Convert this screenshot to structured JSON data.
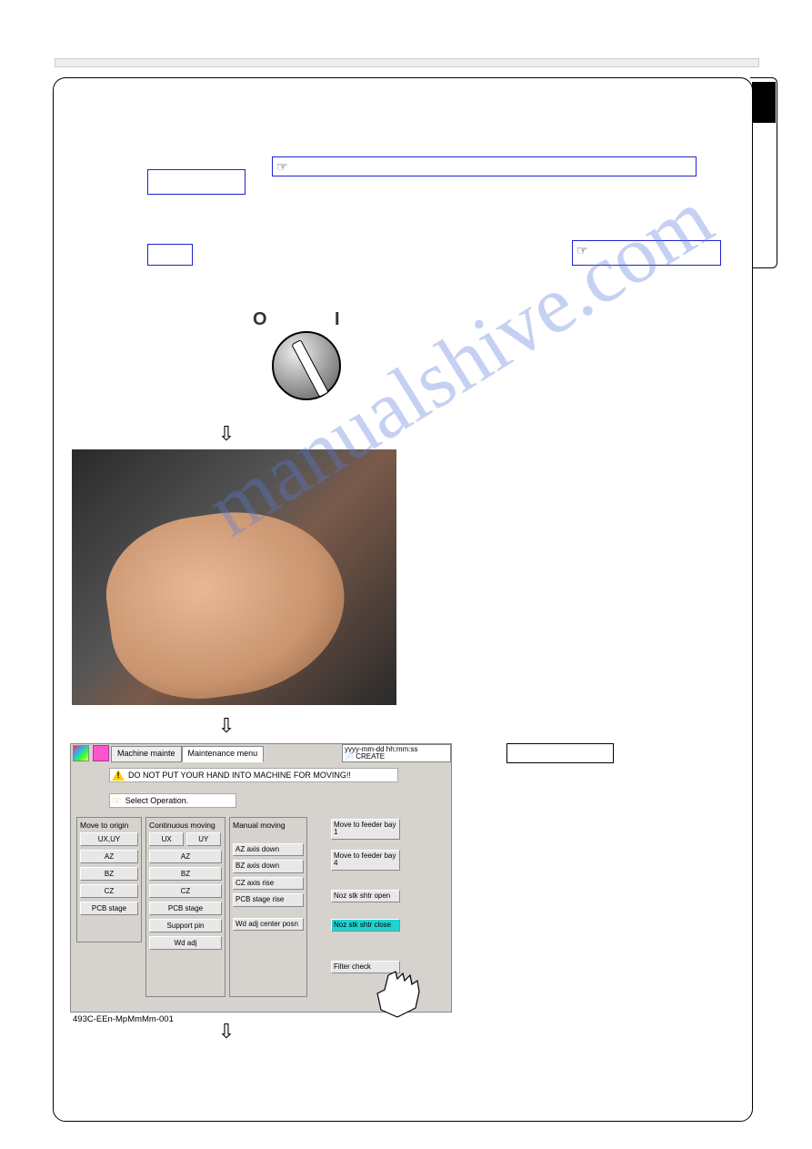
{
  "header": {},
  "frame": {
    "box1_hint": "☞",
    "box2_hint": "☞"
  },
  "knob": {
    "off_label": "O",
    "on_label": "I"
  },
  "watermark": "manualshive.com",
  "screenshot": {
    "tab1": "Machine mainte",
    "tab2": "Maintenance menu",
    "timestamp_line1": "yyyy-mm-dd  hh:mm:ss",
    "timestamp_line2": "CREATE",
    "warning": "DO NOT PUT YOUR HAND INTO MACHINE FOR MOVING!!",
    "prompt": "Select Operation.",
    "panel_origin": {
      "title": "Move to origin",
      "buttons": [
        "UX,UY",
        "AZ",
        "BZ",
        "CZ",
        "PCB stage"
      ]
    },
    "panel_cont": {
      "title": "Continuous moving",
      "btn_ux": "UX",
      "btn_uy": "UY",
      "buttons": [
        "AZ",
        "BZ",
        "CZ",
        "PCB stage",
        "Support pin",
        "Wd adj"
      ]
    },
    "panel_manual": {
      "title": "Manual moving",
      "buttons": [
        "AZ axis down",
        "BZ axis down",
        "CZ axis rise",
        "PCB stage rise",
        "Wd adj center posn"
      ]
    },
    "right_buttons": {
      "r1": "Move to feeder bay 1",
      "r2": "Move to feeder bay 4",
      "r3": "Noz stk shtr open",
      "r4": "Noz stk shtr close",
      "r5": "Filter check"
    },
    "footer_code": "493C-EEn-MpMmMm-001"
  }
}
